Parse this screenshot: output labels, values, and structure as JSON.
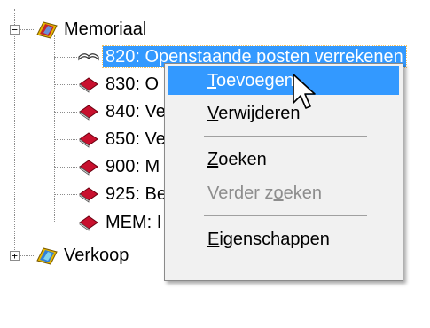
{
  "tree": {
    "memoriaal": {
      "label": "Memoriaal",
      "expander": "−"
    },
    "children": [
      {
        "label": "820: Openstaande posten verrekenen",
        "icon": "open-book-icon",
        "selected": true
      },
      {
        "label": "830: O",
        "icon": "closed-book-icon"
      },
      {
        "label": "840: Ve",
        "icon": "closed-book-icon"
      },
      {
        "label": "850: Ve",
        "icon": "closed-book-icon"
      },
      {
        "label": "900: M",
        "icon": "closed-book-icon"
      },
      {
        "label": "925: Be",
        "icon": "closed-book-icon"
      },
      {
        "label": "MEM: I",
        "icon": "closed-book-icon"
      }
    ],
    "verkoop": {
      "label": "Verkoop",
      "expander": "+"
    }
  },
  "context_menu": {
    "items": [
      {
        "label": "Toevoegen",
        "mnemonic": "T",
        "state": "highlighted"
      },
      {
        "label": "Verwijderen",
        "mnemonic": "V",
        "state": "enabled"
      },
      {
        "label": "Zoeken",
        "mnemonic": "Z",
        "state": "enabled"
      },
      {
        "label": "Verder zoeken",
        "mnemonic": "o",
        "state": "disabled"
      },
      {
        "label": "Eigenschappen",
        "mnemonic": "E",
        "state": "enabled"
      }
    ]
  },
  "colors": {
    "selection": "#3399ff",
    "menu_bg": "#f1f1f1",
    "book_red": "#c8102e"
  }
}
